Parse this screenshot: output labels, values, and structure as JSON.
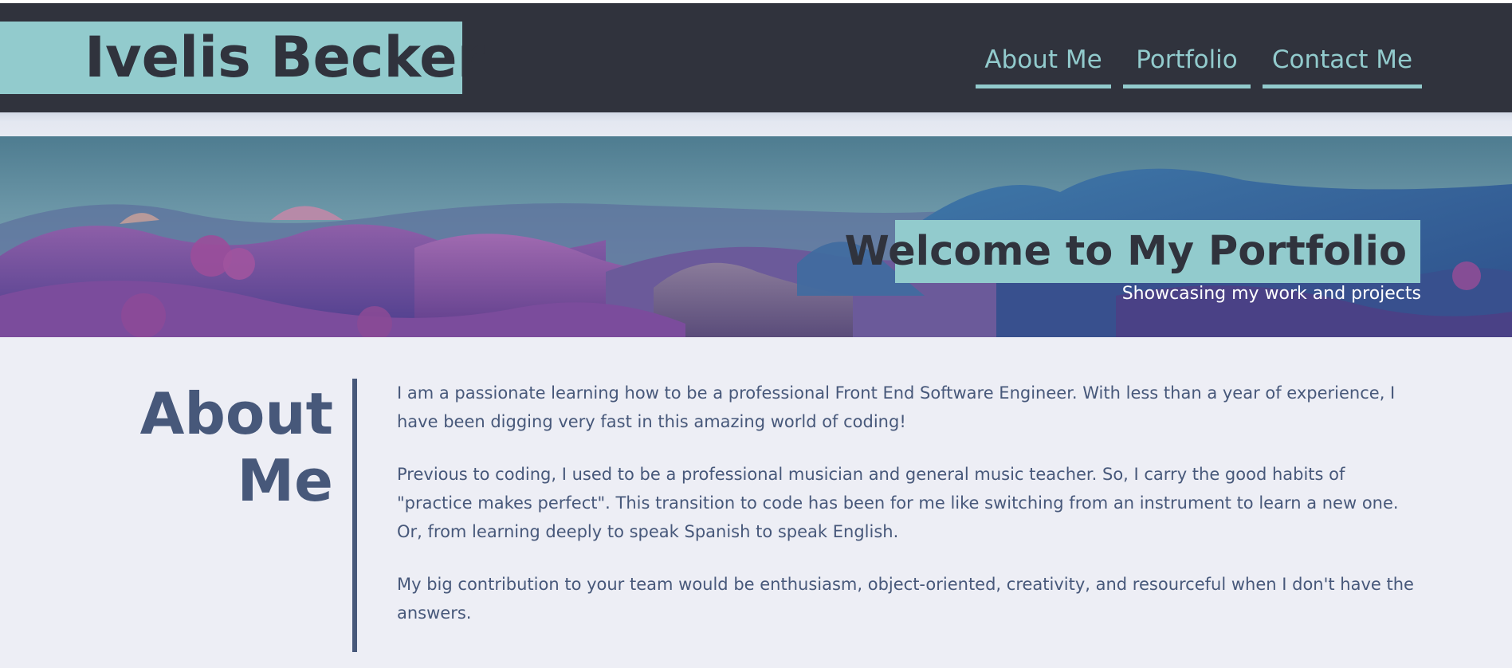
{
  "header": {
    "site_title": "Ivelis Becker",
    "nav": [
      {
        "label": "About Me"
      },
      {
        "label": "Portfolio"
      },
      {
        "label": "Contact Me"
      }
    ]
  },
  "hero": {
    "title": "Welcome to My Portfolio",
    "subtitle": "Showcasing my work and projects"
  },
  "about": {
    "heading_line1": "About",
    "heading_line2": "Me",
    "paragraphs": [
      "I am a passionate learning how to be a professional Front End Software Engineer. With less than a year of experience, I have been digging very fast in this amazing world of coding!",
      "Previous to coding, I used to be a professional musician and general music teacher. So, I carry the good habits of \"practice makes perfect\". This transition to code has been for me like switching from an instrument to learn a new one. Or, from learning deeply to speak Spanish to speak English.",
      "My big contribution to your team would be enthusiasm, object-oriented, creativity, and resourceful when I don't have the answers."
    ]
  },
  "colors": {
    "header_bg": "#30333d",
    "accent": "#92cbcd",
    "text": "#47587a",
    "page_bg": "#edeef5"
  }
}
